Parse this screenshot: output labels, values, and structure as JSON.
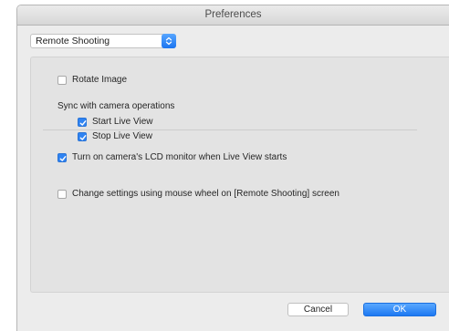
{
  "window": {
    "title": "Preferences"
  },
  "category_select": {
    "value": "Remote Shooting"
  },
  "options": {
    "rotate_image": {
      "label": "Rotate Image",
      "checked": false
    },
    "sync_heading": "Sync with camera operations",
    "start_live_view": {
      "label": "Start Live View",
      "checked": true
    },
    "stop_live_view": {
      "label": "Stop Live View",
      "checked": true
    },
    "lcd_monitor": {
      "label": "Turn on camera's LCD monitor when Live View starts",
      "checked": true
    },
    "mouse_wheel": {
      "label": "Change settings using mouse wheel on [Remote Shooting] screen",
      "checked": false
    }
  },
  "buttons": {
    "cancel": "Cancel",
    "ok": "OK"
  },
  "colors": {
    "accent": "#2f83f2",
    "panel": "#e3e3e3",
    "window": "#ececec"
  }
}
